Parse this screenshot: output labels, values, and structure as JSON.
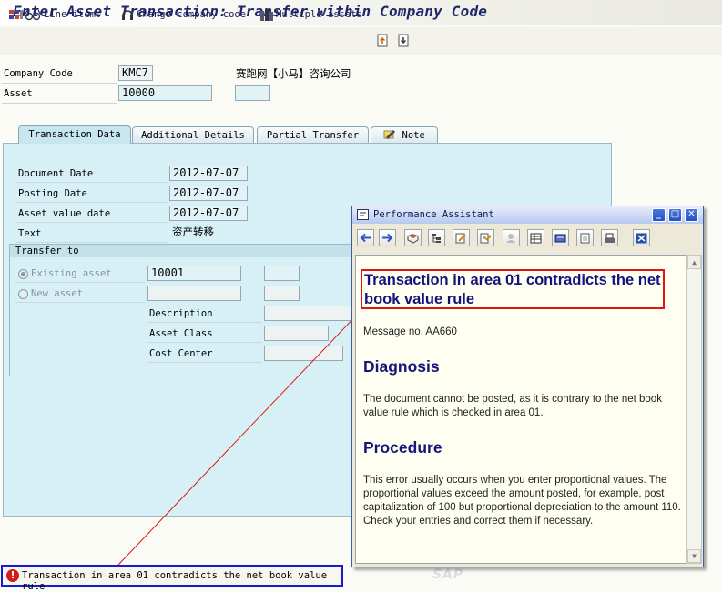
{
  "window": {
    "title": "Enter Asset Transaction: Transfer within Company Code"
  },
  "toolbar": {
    "items": [
      {
        "label": "Line items",
        "icon": "line-items-icon"
      },
      {
        "label": "Change company code",
        "icon": "headset-icon"
      },
      {
        "label": "Multiple assets",
        "icon": "multiple-assets-icon"
      }
    ]
  },
  "header": {
    "company_code_label": "Company Code",
    "company_code_value": "KMC7",
    "company_name": "赛跑网【小马】咨询公司",
    "asset_label": "Asset",
    "asset_value": "10000",
    "asset_sub_value": ""
  },
  "tabs": [
    {
      "label": "Transaction Data",
      "active": true
    },
    {
      "label": "Additional Details",
      "active": false
    },
    {
      "label": "Partial Transfer",
      "active": false
    },
    {
      "label": "Note",
      "active": false,
      "icon": "note-icon"
    }
  ],
  "transaction_data": {
    "document_date_label": "Document Date",
    "document_date_value": "2012-07-07",
    "posting_date_label": "Posting Date",
    "posting_date_value": "2012-07-07",
    "asset_value_date_label": "Asset value date",
    "asset_value_date_value": "2012-07-07",
    "text_label": "Text",
    "text_value": "资产转移"
  },
  "transfer_to": {
    "title": "Transfer to",
    "existing_asset_label": "Existing asset",
    "existing_asset_selected": true,
    "existing_asset_value": "10001",
    "new_asset_label": "New asset",
    "description_label": "Description",
    "asset_class_label": "Asset Class",
    "cost_center_label": "Cost Center"
  },
  "status_bar": {
    "type": "error",
    "message": "Transaction in area 01 contradicts the net book value rule"
  },
  "performance_assistant": {
    "window_title": "Performance Assistant",
    "message_title": "Transaction in area 01 contradicts the net book value rule",
    "message_no": "Message no. AA660",
    "diagnosis_heading": "Diagnosis",
    "diagnosis_text": "The document cannot be posted, as it is contrary to the net book value rule which is checked in area 01.",
    "procedure_heading": "Procedure",
    "procedure_text": "This error usually occurs when you enter proportional values. The proportional values exceed the amount posted, for example, post capitalization of 100 but proportional depreciation to the amount 110. Check your entries and correct them if necessary."
  },
  "branding": {
    "logo_text": "SAP"
  },
  "colors": {
    "title_text": "#20286b",
    "panel_bg": "#d6f0f5",
    "field_bg": "#e2f3f8",
    "error_red": "#d21c1c",
    "highlight_blue": "#1a1ad0",
    "highlight_red": "#e01414",
    "heading_blue": "#15157a"
  }
}
